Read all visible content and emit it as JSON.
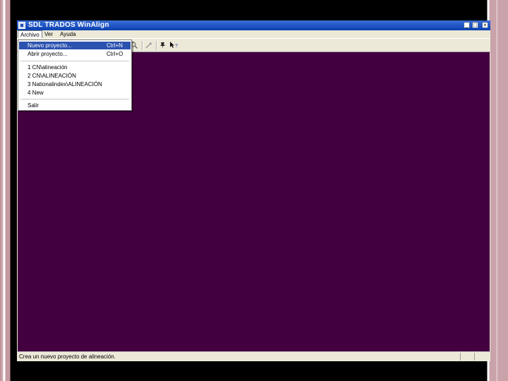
{
  "window": {
    "title": "SDL TRADOS WinAlign",
    "minimize_glyph": "_",
    "maximize_glyph": "□",
    "close_glyph": "×"
  },
  "menubar": {
    "items": [
      {
        "label": "Archivo",
        "active": true
      },
      {
        "label": "Ver",
        "active": false
      },
      {
        "label": "Ayuda",
        "active": false
      }
    ]
  },
  "file_menu": {
    "items": [
      {
        "label": "Nuevo proyecto...",
        "shortcut": "Ctrl+N",
        "highlighted": true
      },
      {
        "label": "Abrir proyecto...",
        "shortcut": "Ctrl+O",
        "highlighted": false
      },
      {
        "label": "1 CN\\alineación",
        "shortcut": "",
        "highlighted": false
      },
      {
        "label": "2 CN\\ALINEACIÓN",
        "shortcut": "",
        "highlighted": false
      },
      {
        "label": "3 Nationalindex\\ALINEACIÓN",
        "shortcut": "",
        "highlighted": false
      },
      {
        "label": "4 New",
        "shortcut": "",
        "highlighted": false
      },
      {
        "label": "Salir",
        "shortcut": "",
        "highlighted": false
      }
    ]
  },
  "toolbar": {
    "icons": [
      "find-icon",
      "wand-icon",
      "pin-icon",
      "help-pointer-icon"
    ]
  },
  "statusbar": {
    "text": "Crea un nuevo proyecto de alineación."
  },
  "colors": {
    "client_background": "#430040",
    "titlebar": "#0a3fb0",
    "menu_highlight": "#2c52b0"
  }
}
